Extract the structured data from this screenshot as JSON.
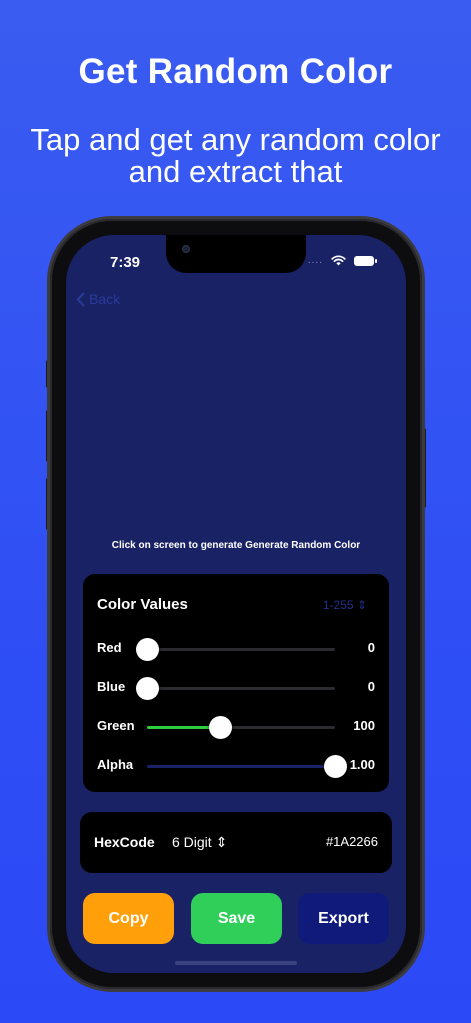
{
  "promo": {
    "headline": "Get Random Color",
    "subline": "Tap and get any random color and extract that"
  },
  "status_bar": {
    "time": "7:39",
    "signal_dots": "....",
    "icons": [
      "wifi-icon",
      "battery-icon"
    ]
  },
  "nav": {
    "back_label": "Back"
  },
  "hint": "Click on screen to generate Generate Random Color",
  "color_values": {
    "title": "Color Values",
    "range_label": "1-255",
    "sliders": [
      {
        "label": "Red",
        "value": "0",
        "level": 0,
        "fill": "#2b2b2f"
      },
      {
        "label": "Blue",
        "value": "0",
        "level": 0,
        "fill": "#2b2b2f"
      },
      {
        "label": "Green",
        "value": "100",
        "level": 0.39,
        "fill": "#2ecc40"
      },
      {
        "label": "Alpha",
        "value": "1.00",
        "level": 1.0,
        "fill": "#1a2266"
      }
    ]
  },
  "hex": {
    "label": "HexCode",
    "digit_mode": "6 Digit",
    "value": "#1A2266"
  },
  "actions": {
    "copy": {
      "label": "Copy",
      "color": "#ff9f0a"
    },
    "save": {
      "label": "Save",
      "color": "#2fcf5a"
    },
    "export": {
      "label": "Export",
      "color": "#101a7a"
    }
  },
  "colors": {
    "background_accent": "#2f4ff5",
    "screen_color": "#1a2266"
  }
}
